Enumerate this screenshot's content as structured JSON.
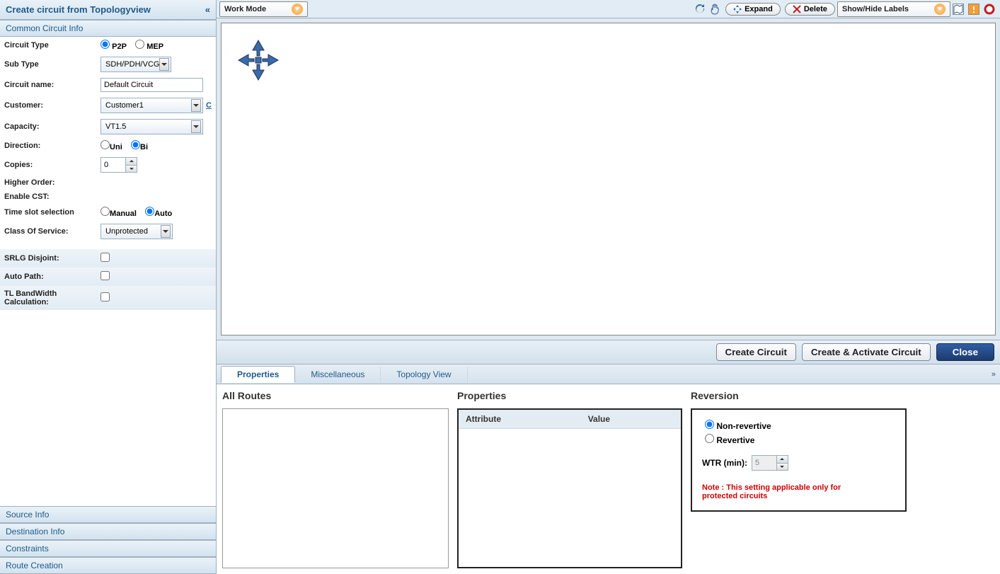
{
  "leftPanel": {
    "title": "Create circuit from Topologyview",
    "section": "Common Circuit Info",
    "form": {
      "circuitTypeLabel": "Circuit Type",
      "p2p": "P2P",
      "mep": "MEP",
      "subTypeLabel": "Sub Type",
      "subTypeValue": "SDH/PDH/VCG",
      "circuitNameLabel": "Circuit name:",
      "circuitNameValue": "Default Circuit",
      "customerLabel": "Customer:",
      "customerValue": "Customer1",
      "customerLink": "C",
      "capacityLabel": "Capacity:",
      "capacityValue": "VT1.5",
      "directionLabel": "Direction:",
      "uni": "Uni",
      "bi": "Bi",
      "copiesLabel": "Copies:",
      "copiesValue": "0",
      "higherOrderLabel": "Higher Order:",
      "enableCSTLabel": "Enable CST:",
      "timeSlotLabel": "Time slot selection",
      "manual": "Manual",
      "auto": "Auto",
      "cosLabel": "Class Of Service:",
      "cosValue": "Unprotected",
      "srlgLabel": "SRLG Disjoint:",
      "autoPathLabel": "Auto Path:",
      "tlBandwidthLabel": "TL BandWidth Calculation:"
    },
    "navSections": [
      "Source Info",
      "Destination Info",
      "Constraints",
      "Route Creation"
    ]
  },
  "toolbar": {
    "workMode": "Work Mode",
    "expand": "Expand",
    "delete": "Delete",
    "showHideLabels": "Show/Hide Labels"
  },
  "footer": {
    "create": "Create Circuit",
    "createActivate": "Create & Activate Circuit",
    "close": "Close"
  },
  "tabs": {
    "properties": "Properties",
    "misc": "Miscellaneous",
    "topo": "Topology View"
  },
  "propsPane": {
    "allRoutes": "All Routes",
    "properties": "Properties",
    "attrHeader": "Attribute",
    "valueHeader": "Value",
    "reversion": "Reversion",
    "nonRevertive": "Non-revertive",
    "revertive": "Revertive",
    "wtrLabel": "WTR (min):",
    "wtrValue": "5",
    "note": "Note : This setting applicable only for protected circuits"
  }
}
